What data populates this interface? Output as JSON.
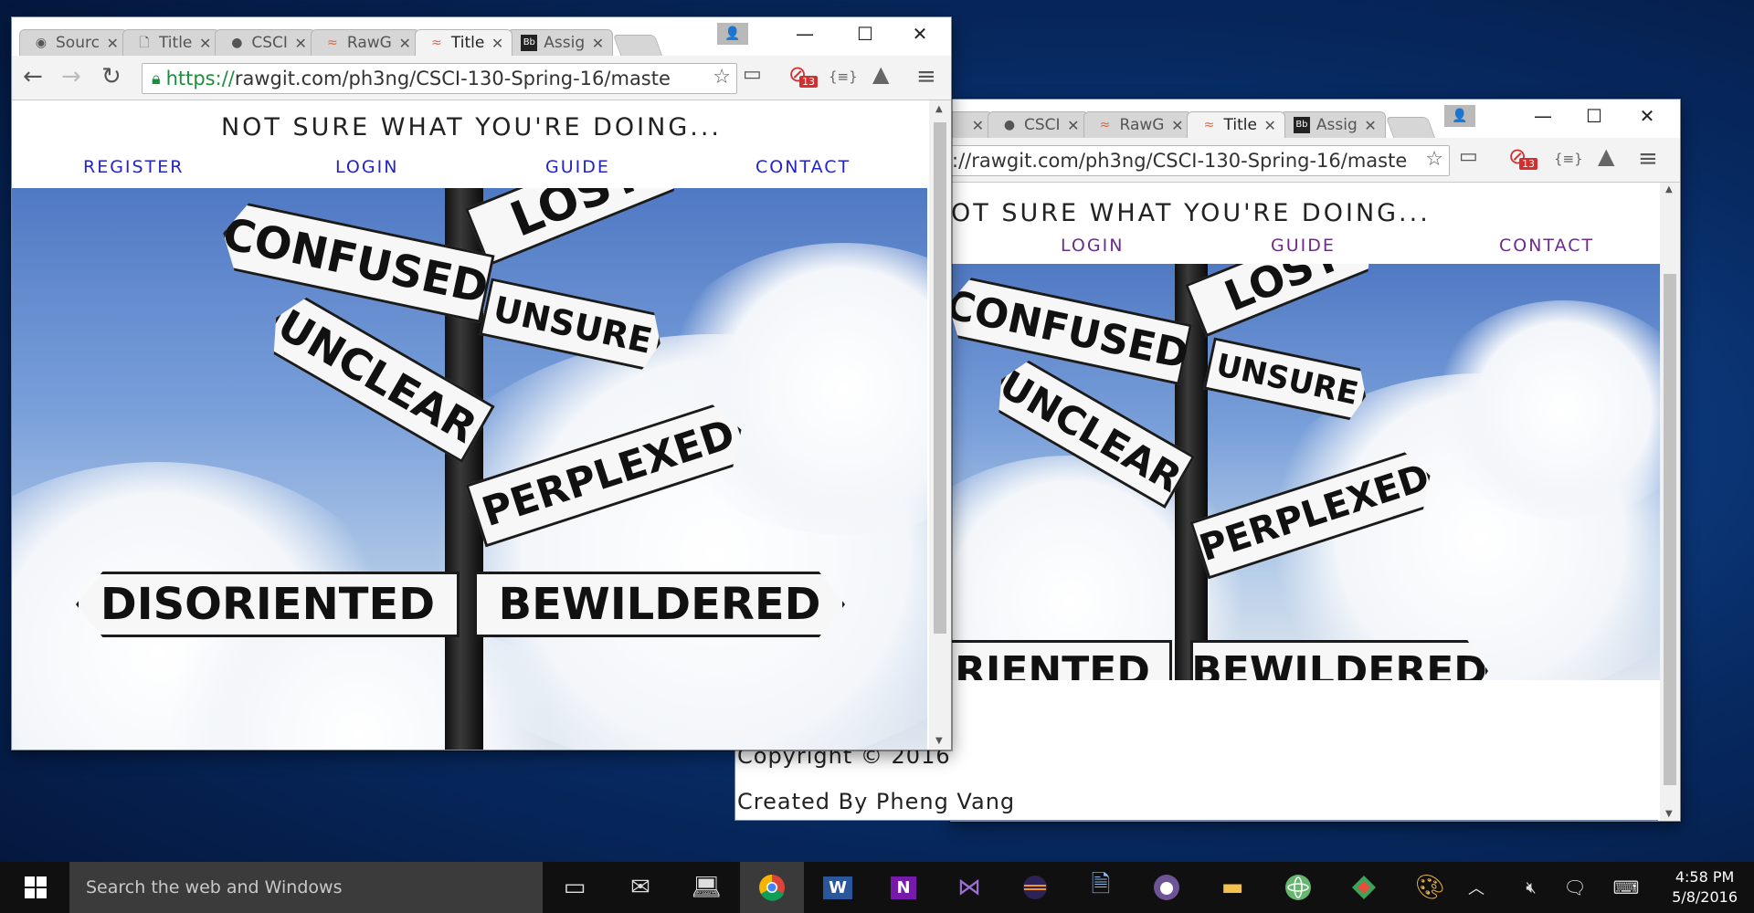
{
  "window_front": {
    "tabs": [
      {
        "label": "Sourc",
        "icon": "eye-icon"
      },
      {
        "label": "Title",
        "icon": "page-icon"
      },
      {
        "label": "CSCI",
        "icon": "github-icon"
      },
      {
        "label": "RawG",
        "icon": "rawgit-icon"
      },
      {
        "label": "Title",
        "icon": "rawgit-icon",
        "active": true
      },
      {
        "label": "Assig",
        "icon": "blackboard-icon"
      }
    ],
    "url_scheme": "https://",
    "url_rest": "rawgit.com/ph3ng/CSCI-130-Spring-16/maste",
    "ext_badge": "13"
  },
  "window_back": {
    "tabs": [
      {
        "label": "CSCI",
        "icon": "github-icon"
      },
      {
        "label": "RawG",
        "icon": "rawgit-icon"
      },
      {
        "label": "Title",
        "icon": "rawgit-icon",
        "active": true
      },
      {
        "label": "Assig",
        "icon": "blackboard-icon"
      }
    ],
    "url": "://rawgit.com/ph3ng/CSCI-130-Spring-16/maste",
    "ext_badge": "13"
  },
  "page": {
    "heading_front": "NOT SURE WHAT YOU'RE DOING...",
    "heading_back": "OT SURE WHAT YOU'RE DOING...",
    "nav": [
      "REGISTER",
      "LOGIN",
      "GUIDE",
      "CONTACT"
    ],
    "nav_color_front": "#2323c8",
    "nav_color_back": "#6b2c8a",
    "signs": [
      "LOST",
      "CONFUSED",
      "UNSURE",
      "UNCLEAR",
      "PERPLEXED",
      "DISORIENTED",
      "BEWILDERED"
    ],
    "signs_back_cut": [
      "RIENTED",
      "BEWILDERED"
    ],
    "footer_copyright": "Copyright © 2016",
    "footer_credit": "Created By Pheng Vang"
  },
  "taskbar": {
    "search_placeholder": "Search the web and Windows",
    "apps": [
      "task-view-icon",
      "mail-icon",
      "computer-icon",
      "chrome-icon",
      "word-icon",
      "onenote-icon",
      "visual-studio-icon",
      "eclipse-icon",
      "notepad-icon",
      "github-desktop-icon",
      "file-explorer-icon",
      "atom-icon",
      "gitkraken-icon",
      "paint-icon"
    ],
    "time": "4:58 PM",
    "date": "5/8/2016"
  }
}
